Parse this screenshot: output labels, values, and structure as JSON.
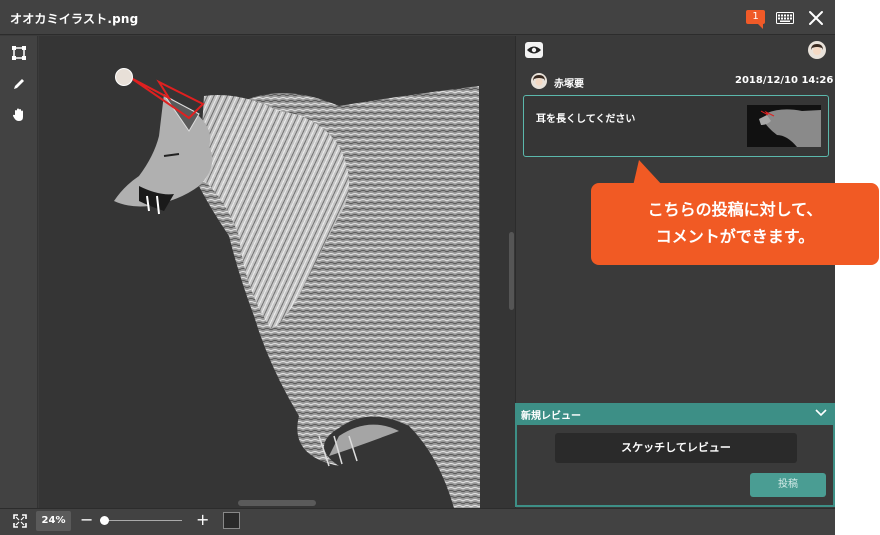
{
  "window": {
    "title": "オオカミイラスト.png",
    "notification_count": "1"
  },
  "icons": {
    "keyboard": "keyboard-icon",
    "close": "close-icon",
    "crop": "crop-icon",
    "pencil": "pencil-icon",
    "hand": "hand-icon",
    "eye": "eye-icon",
    "fit": "fit-screen-icon",
    "chevron": "chevron-down-icon"
  },
  "comment": {
    "author": "赤塚要",
    "date": "2018/12/10 14:26",
    "text": "耳を長くしてください"
  },
  "callout": {
    "line1": "こちらの投稿に対して、",
    "line2": "コメントができます。"
  },
  "review": {
    "title": "新規レビュー",
    "sketch_button": "スケッチしてレビュー",
    "post_button": "投稿"
  },
  "zoom": {
    "value": "24%",
    "minus": "−",
    "plus": "+",
    "slider_level": 0.05
  },
  "colors": {
    "accent_teal": "#3d8f86",
    "callout_orange": "#f15a24",
    "annotation_red": "#e02020"
  }
}
